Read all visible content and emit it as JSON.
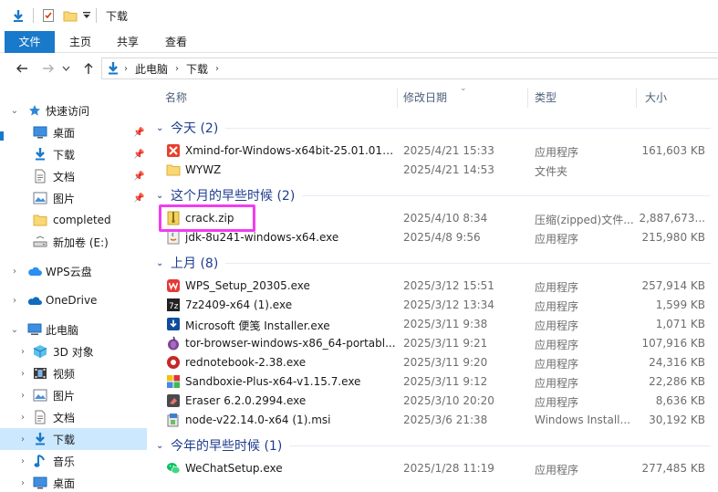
{
  "window": {
    "title": "下载"
  },
  "ribbon": {
    "tabs": [
      "文件",
      "主页",
      "共享",
      "查看"
    ]
  },
  "address": {
    "crumbs": [
      "此电脑",
      "下载"
    ]
  },
  "nav": {
    "quick_access": "快速访问",
    "items": [
      {
        "label": "桌面",
        "icon": "desktop-icon",
        "pinned": true
      },
      {
        "label": "下载",
        "icon": "download-icon",
        "pinned": true
      },
      {
        "label": "文档",
        "icon": "document-icon",
        "pinned": true
      },
      {
        "label": "图片",
        "icon": "picture-icon",
        "pinned": true
      },
      {
        "label": "completed",
        "icon": "folder-icon",
        "pinned": false
      },
      {
        "label": "新加卷 (E:)",
        "icon": "drive-icon",
        "pinned": false
      }
    ],
    "wps": "WPS云盘",
    "onedrive": "OneDrive",
    "this_pc": "此电脑",
    "pc_items": [
      {
        "label": "3D 对象",
        "icon": "cube-icon"
      },
      {
        "label": "视频",
        "icon": "video-icon"
      },
      {
        "label": "图片",
        "icon": "picture-icon"
      },
      {
        "label": "文档",
        "icon": "document-icon"
      },
      {
        "label": "下载",
        "icon": "download-icon"
      },
      {
        "label": "音乐",
        "icon": "music-icon"
      },
      {
        "label": "桌面",
        "icon": "desktop-icon"
      }
    ]
  },
  "columns": {
    "name": "名称",
    "date": "修改日期",
    "type": "类型",
    "size": "大小"
  },
  "groups": [
    {
      "label": "今天 (2)",
      "files": [
        {
          "name": "Xmind-for-Windows-x64bit-25.01.010...",
          "date": "2025/4/21 15:33",
          "type": "应用程序",
          "size": "161,603 KB",
          "icon": "xmind-icon"
        },
        {
          "name": "WYWZ",
          "date": "2025/4/21 14:53",
          "type": "文件夹",
          "size": "",
          "icon": "folder-icon"
        }
      ]
    },
    {
      "label": "这个月的早些时候 (2)",
      "files": [
        {
          "name": "crack.zip",
          "date": "2025/4/10 8:34",
          "type": "压缩(zipped)文件...",
          "size": "2,887,673...",
          "icon": "zip-icon"
        },
        {
          "name": "jdk-8u241-windows-x64.exe",
          "date": "2025/4/8 9:56",
          "type": "应用程序",
          "size": "215,980 KB",
          "icon": "java-icon"
        }
      ]
    },
    {
      "label": "上月 (8)",
      "files": [
        {
          "name": "WPS_Setup_20305.exe",
          "date": "2025/3/12 15:51",
          "type": "应用程序",
          "size": "257,914 KB",
          "icon": "wps-icon"
        },
        {
          "name": "7z2409-x64 (1).exe",
          "date": "2025/3/12 13:34",
          "type": "应用程序",
          "size": "1,599 KB",
          "icon": "sevenzip-icon"
        },
        {
          "name": "Microsoft 便笺 Installer.exe",
          "date": "2025/3/11 9:38",
          "type": "应用程序",
          "size": "1,071 KB",
          "icon": "installer-icon"
        },
        {
          "name": "tor-browser-windows-x86_64-portabl...",
          "date": "2025/3/11 9:21",
          "type": "应用程序",
          "size": "107,916 KB",
          "icon": "tor-icon"
        },
        {
          "name": "rednotebook-2.38.exe",
          "date": "2025/3/11 9:20",
          "type": "应用程序",
          "size": "24,316 KB",
          "icon": "rednotebook-icon"
        },
        {
          "name": "Sandboxie-Plus-x64-v1.15.7.exe",
          "date": "2025/3/11 9:12",
          "type": "应用程序",
          "size": "22,286 KB",
          "icon": "sandboxie-icon"
        },
        {
          "name": "Eraser 6.2.0.2994.exe",
          "date": "2025/3/10 20:20",
          "type": "应用程序",
          "size": "8,636 KB",
          "icon": "eraser-icon"
        },
        {
          "name": "node-v22.14.0-x64 (1).msi",
          "date": "2025/3/6 21:38",
          "type": "Windows Install...",
          "size": "30,192 KB",
          "icon": "msi-icon"
        }
      ]
    },
    {
      "label": "今年的早些时候 (1)",
      "files": [
        {
          "name": "WeChatSetup.exe",
          "date": "2025/1/28 11:19",
          "type": "应用程序",
          "size": "277,485 KB",
          "icon": "wechat-icon"
        }
      ]
    }
  ],
  "colors": {
    "accent": "#1979ca",
    "selection": "#cce8ff",
    "group_text": "#1e3d8f",
    "highlight_box": "#f23cf0"
  }
}
